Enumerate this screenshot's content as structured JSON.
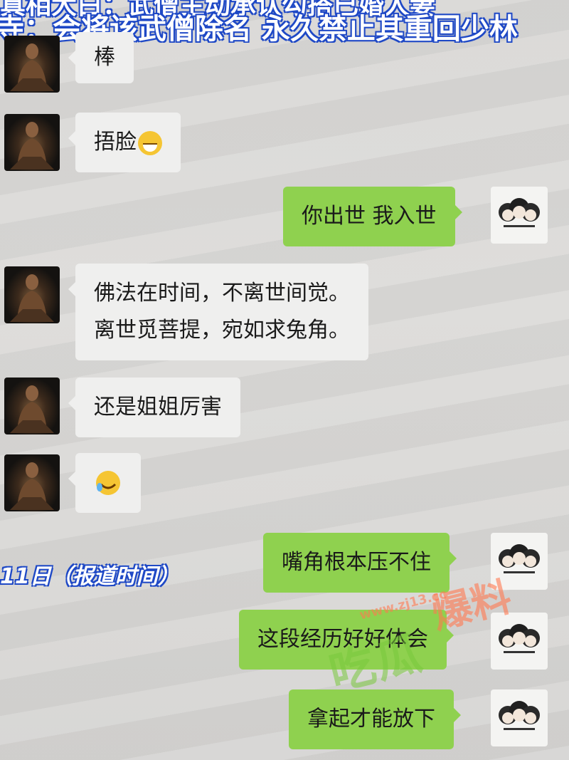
{
  "headline": {
    "line1": "真相大白：武僧主动承认勾搭已婚人妻",
    "line2": "寺：会将该武僧除名 永久禁止其重回少林"
  },
  "date_label": "11日（报道时间）",
  "messages": [
    {
      "side": "left",
      "text": "棒"
    },
    {
      "side": "left",
      "text": "捂脸",
      "emoji": "grin-emoji-icon"
    },
    {
      "side": "right",
      "text": "你出世 我入世"
    },
    {
      "side": "left",
      "line1": "佛法在时间，不离世间觉。",
      "line2": "离世觅菩提，宛如求兔角。"
    },
    {
      "side": "left",
      "text": "还是姐姐厉害"
    },
    {
      "side": "left",
      "emoji": "laughing-tears-emoji-icon"
    },
    {
      "side": "right",
      "text": "嘴角根本压不住"
    },
    {
      "side": "right",
      "text": "这段经历好好体会"
    },
    {
      "side": "right",
      "text": "拿起才能放下"
    }
  ],
  "watermark": {
    "site": "www.zj13.cc",
    "main": "吃瓜",
    "cn": "爆料"
  }
}
